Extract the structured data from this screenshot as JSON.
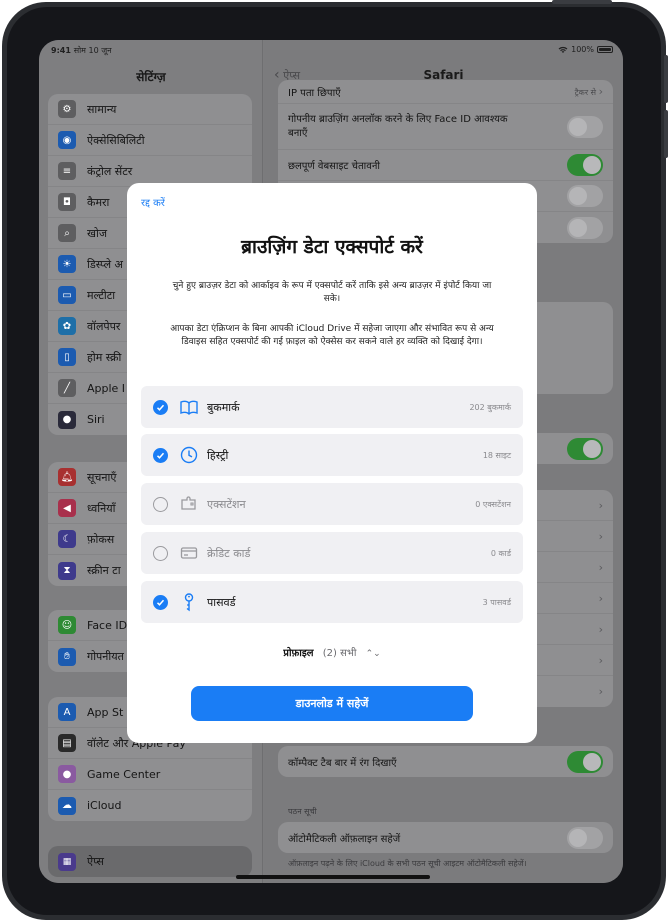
{
  "status": {
    "time": "9:41",
    "date": "सोम 10 जून",
    "battery": "100%"
  },
  "sidebar": {
    "title": "सेटिंग्ज़",
    "group1": [
      "सामान्य",
      "ऐक्सेसिबिलिटी",
      "कंट्रोल सेंटर",
      "कैमरा",
      "खोज",
      "डिस्प्ले अ",
      "मल्टीटा",
      "वॉलपेपर",
      "होम स्क्री",
      "Apple I",
      "Siri"
    ],
    "group2": [
      "सूचनाएँ",
      "ध्वनियाँ",
      "फ़ोकस",
      "स्क्रीन टा"
    ],
    "group3": [
      "Face ID",
      "गोपनीयत"
    ],
    "group4": [
      "App St",
      "वॉलेट और Apple Pay",
      "Game Center",
      "iCloud"
    ],
    "selected": "ऐप्स"
  },
  "detail": {
    "back": "ऐप्स",
    "title": "Safari",
    "rows_top": [
      {
        "label": "IP पता छिपाएँ",
        "value": "ट्रैकर से"
      },
      {
        "label": "गोपनीय ब्राउज़िंग अनलॉक करने के लिए Face ID आवश्यक बनाएँ"
      },
      {
        "label": "छलपूर्ण वेबसाइट चेतावनी"
      }
    ],
    "compact_tab": "कॉम्पैक्ट टैब बार में रंग दिखाएँ",
    "reading_header": "पठन सूची",
    "auto_offline": "ऑटोमैटिकली ऑफ़लाइन सहेजें",
    "reading_footer": "ऑफ़लाइन पढ़ने के लिए iCloud के सभी पठन सूची आइटम ऑटोमैटिकली सहेजें।"
  },
  "modal": {
    "cancel": "रद्द करें",
    "title": "ब्राउज़िंग डेटा एक्सपोर्ट करें",
    "desc1": "चुने हुए ब्राउज़र डेटा को आर्काइव के रूप में एक्सपोर्ट करें ताकि इसे अन्य ब्राउज़र में इंपोर्ट किया जा सके।",
    "desc2": "आपका डेटा एंक्रिप्शन के बिना आपकी iCloud Drive में सहेजा जाएगा और संभावित रूप से अन्य डिवाइस सहित एक्सपोर्ट की गई फ़ाइल को ऐक्सेस कर सकने वाले हर व्यक्ति को दिखाई देगा।",
    "items": [
      {
        "label": "बुकमार्क",
        "count": "202 बुकमार्क",
        "checked": true,
        "icon": "book-icon"
      },
      {
        "label": "हिस्ट्री",
        "count": "18 साइट",
        "checked": true,
        "icon": "clock-icon"
      },
      {
        "label": "एक्सटेंशन",
        "count": "0 एक्सटेंशन",
        "checked": false,
        "icon": "puzzle-icon"
      },
      {
        "label": "क्रेडिट कार्ड",
        "count": "0 कार्ड",
        "checked": false,
        "icon": "credit-card-icon"
      },
      {
        "label": "पासवर्ड",
        "count": "3 पासवर्ड",
        "checked": true,
        "icon": "key-icon"
      }
    ],
    "profile_label": "प्रोफ़ाइल",
    "profile_value": "(2) सभी",
    "download": "डाउनलोड में सहेजें"
  },
  "colors": {
    "accent": "#1a7df5",
    "toggle_on": "#34c759"
  }
}
